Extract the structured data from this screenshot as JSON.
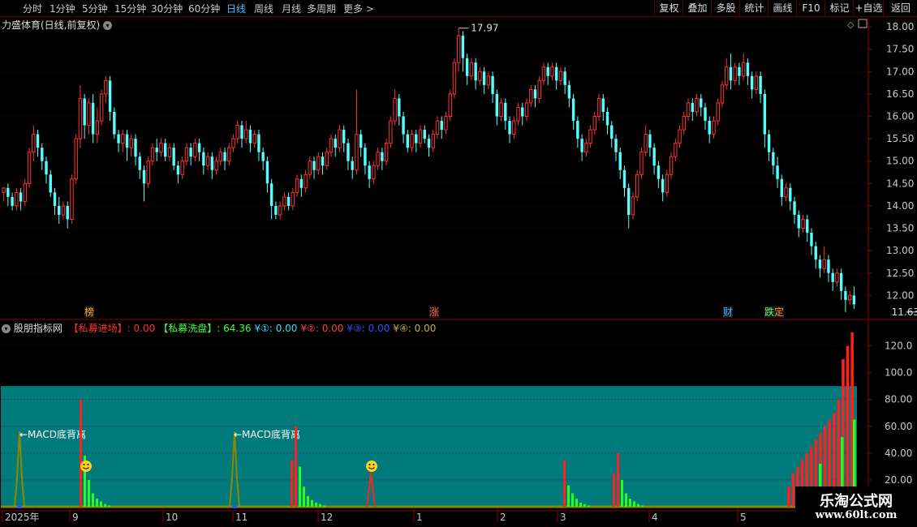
{
  "toolbar": {
    "tabs": [
      {
        "label": "分时",
        "active": false
      },
      {
        "label": "1分钟",
        "active": false
      },
      {
        "label": "5分钟",
        "active": false
      },
      {
        "label": "15分钟",
        "active": false
      },
      {
        "label": "30分钟",
        "active": false
      },
      {
        "label": "60分钟",
        "active": false
      },
      {
        "label": "日线",
        "active": true
      },
      {
        "label": "周线",
        "active": false
      },
      {
        "label": "月线",
        "active": false
      },
      {
        "label": "多周期",
        "active": false
      },
      {
        "label": "更多 >",
        "active": false
      }
    ],
    "right_buttons": [
      "复权",
      "叠加",
      "多股",
      "统计",
      "画线",
      "F10",
      "标记",
      "+自选",
      "返回"
    ]
  },
  "main_chart": {
    "title": "力盛体育(日线,前复权)",
    "high_label": "17.97",
    "low_label": "11.63",
    "y_ticks": [
      "18.00",
      "17.50",
      "17.00",
      "16.50",
      "16.00",
      "15.50",
      "15.00",
      "14.50",
      "14.00",
      "13.50",
      "13.00",
      "12.50",
      "12.00"
    ],
    "event_markers": [
      "榜",
      "涨",
      "财",
      "跌",
      "定"
    ]
  },
  "indicator": {
    "name": "股朋指标网",
    "fields": [
      {
        "label": "【私募进场】: 0.00",
        "color": "#ff3030"
      },
      {
        "label": "【私募洗盘】: 64.36",
        "color": "#40ff40"
      },
      {
        "label": "¥①: 0.00",
        "color": "#40d8ff"
      },
      {
        "label": "¥②: 0.00",
        "color": "#ff4040"
      },
      {
        "label": "¥③: 0.00",
        "color": "#3050ff"
      },
      {
        "label": "¥④: 0.00",
        "color": "#c8b040"
      }
    ],
    "y_ticks": [
      "120.0",
      "100.0",
      "80.00",
      "60.00",
      "40.00",
      "20.00"
    ],
    "annotations": [
      "←MACD底背离",
      "←MACD底背离"
    ]
  },
  "x_axis": {
    "labels": [
      "2025年",
      "9",
      "10",
      "11",
      "12",
      "1",
      "2",
      "3",
      "4",
      "5"
    ]
  },
  "watermark": {
    "line1": "乐淘公式网",
    "line2": "www.60lt.com"
  },
  "chart_data": {
    "type": "candlestick",
    "title": "力盛体育(日线,前复权)",
    "ylim": [
      11.5,
      18.2
    ],
    "candles": [
      [
        14.3,
        14.4,
        14.1,
        14.4
      ],
      [
        14.4,
        14.2,
        14.0,
        14.5
      ],
      [
        14.2,
        14.0,
        13.9,
        14.3
      ],
      [
        14.0,
        14.3,
        13.9,
        14.4
      ],
      [
        14.3,
        14.1,
        13.9,
        14.4
      ],
      [
        14.1,
        14.5,
        14.0,
        14.6
      ],
      [
        14.5,
        15.2,
        14.4,
        15.3
      ],
      [
        15.2,
        15.6,
        15.0,
        15.8
      ],
      [
        15.6,
        15.3,
        15.1,
        15.7
      ],
      [
        15.3,
        15.0,
        14.8,
        15.4
      ],
      [
        15.0,
        14.7,
        14.5,
        15.1
      ],
      [
        14.7,
        14.3,
        14.2,
        14.8
      ],
      [
        14.3,
        14.0,
        13.8,
        14.4
      ],
      [
        14.0,
        13.8,
        13.6,
        14.2
      ],
      [
        13.8,
        14.0,
        13.7,
        14.1
      ],
      [
        14.0,
        13.7,
        13.5,
        14.1
      ],
      [
        13.7,
        14.6,
        13.6,
        14.7
      ],
      [
        14.6,
        15.5,
        14.5,
        15.6
      ],
      [
        15.5,
        16.4,
        15.3,
        16.7
      ],
      [
        16.4,
        15.8,
        15.5,
        16.5
      ],
      [
        15.8,
        16.3,
        15.6,
        16.4
      ],
      [
        16.3,
        15.6,
        15.4,
        16.5
      ],
      [
        15.6,
        15.9,
        15.4,
        16.2
      ],
      [
        15.9,
        16.5,
        15.8,
        16.6
      ],
      [
        16.5,
        16.8,
        16.3,
        16.9
      ],
      [
        16.8,
        16.1,
        15.9,
        16.9
      ],
      [
        16.1,
        15.6,
        15.5,
        16.2
      ],
      [
        15.6,
        15.4,
        15.2,
        15.7
      ],
      [
        15.4,
        15.6,
        15.2,
        15.7
      ],
      [
        15.6,
        15.3,
        15.0,
        15.7
      ],
      [
        15.3,
        15.5,
        15.1,
        15.6
      ],
      [
        15.5,
        15.1,
        14.9,
        15.6
      ],
      [
        15.1,
        14.8,
        14.6,
        15.2
      ],
      [
        14.8,
        14.5,
        14.1,
        14.9
      ],
      [
        14.5,
        15.0,
        14.4,
        15.1
      ],
      [
        15.0,
        15.3,
        14.9,
        15.4
      ],
      [
        15.3,
        15.2,
        15.0,
        15.5
      ],
      [
        15.2,
        15.4,
        15.1,
        15.5
      ],
      [
        15.4,
        15.1,
        15.0,
        15.5
      ],
      [
        15.1,
        15.3,
        15.0,
        15.4
      ],
      [
        15.3,
        14.9,
        14.8,
        15.4
      ],
      [
        14.9,
        14.7,
        14.5,
        15.0
      ],
      [
        14.7,
        15.0,
        14.6,
        15.1
      ],
      [
        15.0,
        15.3,
        14.9,
        15.4
      ],
      [
        15.3,
        15.1,
        14.9,
        15.4
      ],
      [
        15.1,
        15.4,
        15.0,
        15.5
      ],
      [
        15.4,
        15.2,
        15.0,
        15.5
      ],
      [
        15.2,
        14.9,
        14.7,
        15.3
      ],
      [
        14.9,
        15.1,
        14.8,
        15.2
      ],
      [
        15.1,
        14.8,
        14.6,
        15.2
      ],
      [
        14.8,
        15.0,
        14.7,
        15.1
      ],
      [
        15.0,
        15.2,
        14.9,
        15.3
      ],
      [
        15.2,
        15.0,
        14.8,
        15.3
      ],
      [
        15.0,
        15.3,
        14.9,
        15.4
      ],
      [
        15.3,
        15.5,
        15.2,
        15.6
      ],
      [
        15.5,
        15.8,
        15.4,
        15.9
      ],
      [
        15.8,
        15.5,
        15.3,
        15.9
      ],
      [
        15.5,
        15.7,
        15.4,
        15.9
      ],
      [
        15.7,
        15.4,
        15.2,
        15.8
      ],
      [
        15.4,
        15.6,
        15.3,
        15.7
      ],
      [
        15.6,
        15.2,
        15.0,
        15.7
      ],
      [
        15.2,
        15.0,
        14.8,
        15.3
      ],
      [
        15.0,
        14.5,
        14.3,
        15.1
      ],
      [
        14.5,
        14.0,
        13.7,
        14.6
      ],
      [
        14.0,
        13.8,
        13.7,
        14.1
      ],
      [
        13.8,
        14.0,
        13.7,
        14.1
      ],
      [
        14.0,
        14.2,
        13.9,
        14.3
      ],
      [
        14.2,
        14.0,
        13.9,
        14.3
      ],
      [
        14.0,
        14.3,
        13.9,
        14.4
      ],
      [
        14.3,
        14.6,
        14.2,
        14.7
      ],
      [
        14.6,
        14.4,
        14.2,
        14.7
      ],
      [
        14.4,
        14.7,
        14.3,
        14.8
      ],
      [
        14.7,
        15.0,
        14.6,
        15.1
      ],
      [
        15.0,
        14.8,
        14.6,
        15.1
      ],
      [
        14.8,
        15.1,
        14.7,
        15.2
      ],
      [
        15.1,
        14.9,
        14.7,
        15.2
      ],
      [
        14.9,
        15.2,
        14.8,
        15.3
      ],
      [
        15.2,
        15.5,
        15.1,
        15.6
      ],
      [
        15.5,
        15.3,
        15.1,
        15.6
      ],
      [
        15.3,
        15.7,
        15.2,
        15.8
      ],
      [
        15.7,
        15.4,
        15.2,
        15.8
      ],
      [
        15.4,
        15.0,
        14.8,
        15.5
      ],
      [
        15.0,
        14.8,
        14.6,
        15.1
      ],
      [
        14.8,
        15.6,
        14.7,
        16.6
      ],
      [
        15.6,
        15.3,
        15.1,
        15.7
      ],
      [
        15.3,
        14.9,
        14.7,
        15.4
      ],
      [
        14.9,
        14.6,
        14.4,
        15.0
      ],
      [
        14.6,
        14.9,
        14.5,
        15.0
      ],
      [
        14.9,
        15.2,
        14.8,
        15.3
      ],
      [
        15.2,
        15.0,
        14.8,
        15.3
      ],
      [
        15.0,
        15.4,
        14.9,
        15.5
      ],
      [
        15.4,
        15.9,
        15.3,
        16.0
      ],
      [
        15.9,
        16.4,
        15.8,
        16.6
      ],
      [
        16.4,
        16.0,
        15.8,
        16.5
      ],
      [
        16.0,
        15.6,
        15.4,
        16.1
      ],
      [
        15.6,
        15.3,
        15.2,
        15.7
      ],
      [
        15.3,
        15.6,
        15.2,
        15.7
      ],
      [
        15.6,
        15.4,
        15.2,
        15.7
      ],
      [
        15.4,
        15.7,
        15.3,
        15.8
      ],
      [
        15.7,
        15.5,
        15.4,
        15.8
      ],
      [
        15.5,
        15.3,
        15.1,
        15.6
      ],
      [
        15.3,
        15.6,
        15.2,
        15.7
      ],
      [
        15.6,
        15.9,
        15.5,
        16.0
      ],
      [
        15.9,
        15.7,
        15.5,
        16.0
      ],
      [
        15.7,
        16.0,
        15.6,
        16.1
      ],
      [
        16.0,
        16.5,
        15.9,
        16.6
      ],
      [
        16.5,
        17.2,
        16.4,
        17.3
      ],
      [
        17.2,
        17.8,
        17.0,
        17.97
      ],
      [
        17.8,
        17.3,
        17.0,
        17.9
      ],
      [
        17.3,
        16.9,
        16.7,
        17.4
      ],
      [
        16.9,
        17.2,
        16.8,
        17.3
      ],
      [
        17.2,
        16.8,
        16.6,
        17.3
      ],
      [
        16.8,
        17.0,
        16.7,
        17.1
      ],
      [
        17.0,
        16.7,
        16.5,
        17.1
      ],
      [
        16.7,
        16.9,
        16.6,
        17.0
      ],
      [
        16.9,
        16.5,
        16.3,
        17.0
      ],
      [
        16.5,
        16.0,
        15.8,
        16.6
      ],
      [
        16.0,
        16.3,
        15.9,
        16.4
      ],
      [
        16.3,
        15.9,
        15.7,
        16.4
      ],
      [
        15.9,
        15.6,
        15.4,
        16.0
      ],
      [
        15.6,
        15.9,
        15.5,
        16.0
      ],
      [
        15.9,
        16.2,
        15.8,
        16.3
      ],
      [
        16.2,
        16.0,
        15.8,
        16.3
      ],
      [
        16.0,
        16.3,
        15.9,
        16.4
      ],
      [
        16.3,
        16.6,
        16.2,
        16.7
      ],
      [
        16.6,
        16.4,
        16.2,
        16.7
      ],
      [
        16.4,
        16.8,
        16.3,
        16.9
      ],
      [
        16.8,
        17.1,
        16.7,
        17.2
      ],
      [
        17.1,
        16.9,
        16.7,
        17.2
      ],
      [
        16.9,
        17.1,
        16.8,
        17.2
      ],
      [
        17.1,
        16.8,
        16.6,
        17.2
      ],
      [
        16.8,
        17.0,
        16.7,
        17.1
      ],
      [
        17.0,
        16.7,
        16.5,
        17.1
      ],
      [
        16.7,
        16.4,
        16.2,
        16.8
      ],
      [
        16.4,
        15.9,
        15.7,
        16.5
      ],
      [
        15.9,
        15.5,
        15.3,
        16.0
      ],
      [
        15.5,
        15.2,
        15.0,
        15.6
      ],
      [
        15.2,
        15.4,
        15.1,
        15.5
      ],
      [
        15.4,
        15.7,
        15.3,
        15.8
      ],
      [
        15.7,
        16.0,
        15.6,
        16.1
      ],
      [
        16.0,
        16.4,
        15.9,
        16.5
      ],
      [
        16.4,
        16.1,
        15.9,
        16.5
      ],
      [
        16.1,
        15.8,
        15.6,
        16.2
      ],
      [
        15.8,
        15.5,
        15.3,
        15.9
      ],
      [
        15.5,
        15.2,
        15.0,
        15.6
      ],
      [
        15.2,
        14.8,
        14.6,
        15.3
      ],
      [
        14.8,
        14.4,
        14.2,
        14.9
      ],
      [
        14.4,
        13.8,
        13.5,
        14.5
      ],
      [
        13.8,
        14.2,
        13.7,
        14.3
      ],
      [
        14.2,
        14.7,
        14.1,
        14.8
      ],
      [
        14.7,
        15.2,
        14.6,
        15.3
      ],
      [
        15.2,
        15.6,
        15.1,
        15.8
      ],
      [
        15.6,
        15.3,
        15.1,
        15.7
      ],
      [
        15.3,
        14.9,
        14.7,
        15.4
      ],
      [
        14.9,
        14.6,
        14.4,
        15.0
      ],
      [
        14.6,
        14.3,
        14.1,
        14.7
      ],
      [
        14.3,
        14.7,
        14.2,
        14.8
      ],
      [
        14.7,
        15.1,
        14.6,
        15.2
      ],
      [
        15.1,
        15.4,
        15.0,
        15.5
      ],
      [
        15.4,
        15.7,
        15.3,
        15.8
      ],
      [
        15.7,
        16.0,
        15.6,
        16.1
      ],
      [
        16.0,
        16.3,
        15.9,
        16.4
      ],
      [
        16.3,
        16.1,
        15.9,
        16.4
      ],
      [
        16.1,
        16.4,
        16.0,
        16.5
      ],
      [
        16.4,
        16.2,
        16.0,
        16.5
      ],
      [
        16.2,
        15.9,
        15.7,
        16.3
      ],
      [
        15.9,
        15.6,
        15.4,
        16.0
      ],
      [
        15.6,
        15.9,
        15.5,
        16.0
      ],
      [
        15.9,
        16.3,
        15.8,
        16.4
      ],
      [
        16.3,
        16.7,
        16.2,
        16.8
      ],
      [
        16.7,
        17.1,
        16.6,
        17.3
      ],
      [
        17.1,
        16.8,
        16.6,
        17.4
      ],
      [
        16.8,
        17.1,
        16.7,
        17.2
      ],
      [
        17.1,
        16.9,
        16.7,
        17.2
      ],
      [
        16.9,
        17.2,
        16.8,
        17.4
      ],
      [
        17.2,
        16.9,
        16.7,
        17.3
      ],
      [
        16.9,
        16.6,
        16.4,
        17.0
      ],
      [
        16.6,
        16.9,
        16.5,
        17.0
      ],
      [
        16.9,
        16.5,
        16.3,
        17.0
      ],
      [
        16.5,
        15.6,
        15.3,
        16.6
      ],
      [
        15.6,
        15.2,
        15.0,
        15.7
      ],
      [
        15.2,
        14.9,
        14.7,
        15.3
      ],
      [
        14.9,
        14.6,
        14.4,
        15.1
      ],
      [
        14.6,
        14.2,
        14.0,
        14.7
      ],
      [
        14.2,
        14.4,
        14.1,
        14.5
      ],
      [
        14.4,
        14.1,
        13.9,
        14.5
      ],
      [
        14.1,
        13.8,
        13.6,
        14.2
      ],
      [
        13.8,
        13.5,
        13.3,
        13.9
      ],
      [
        13.5,
        13.7,
        13.4,
        13.8
      ],
      [
        13.7,
        13.4,
        13.2,
        13.8
      ],
      [
        13.4,
        13.1,
        12.9,
        13.5
      ],
      [
        13.1,
        12.8,
        12.6,
        13.2
      ],
      [
        12.8,
        12.6,
        12.4,
        12.9
      ],
      [
        12.6,
        12.8,
        12.5,
        13.1
      ],
      [
        12.8,
        12.5,
        12.3,
        12.9
      ],
      [
        12.5,
        12.3,
        12.1,
        12.6
      ],
      [
        12.3,
        12.5,
        12.2,
        12.6
      ],
      [
        12.5,
        12.1,
        11.9,
        12.6
      ],
      [
        12.1,
        11.9,
        11.63,
        12.2
      ],
      [
        11.9,
        12.0,
        11.8,
        12.1
      ],
      [
        12.0,
        11.8,
        11.7,
        12.2
      ]
    ]
  }
}
